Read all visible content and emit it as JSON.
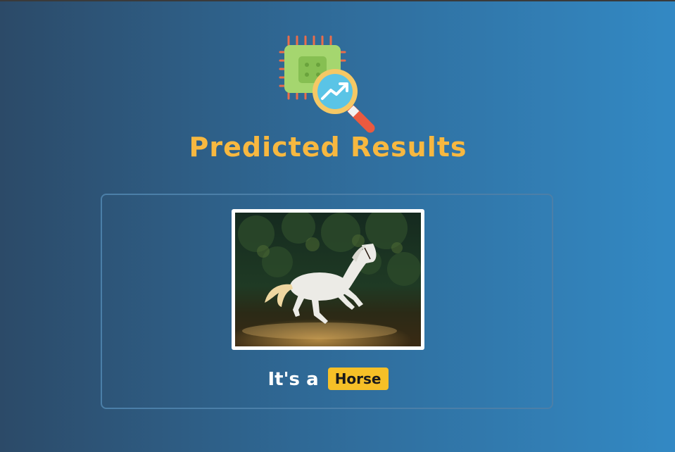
{
  "header": {
    "title": "Predicted Results",
    "logo_icon": "chip-magnifier-analytics-icon"
  },
  "result": {
    "image_icon": "white-horse-photo",
    "prefix": "It's a",
    "label": "Horse"
  },
  "colors": {
    "title": "#f7b840",
    "badge": "#f6c027",
    "card_border": "#4b7fa8"
  }
}
